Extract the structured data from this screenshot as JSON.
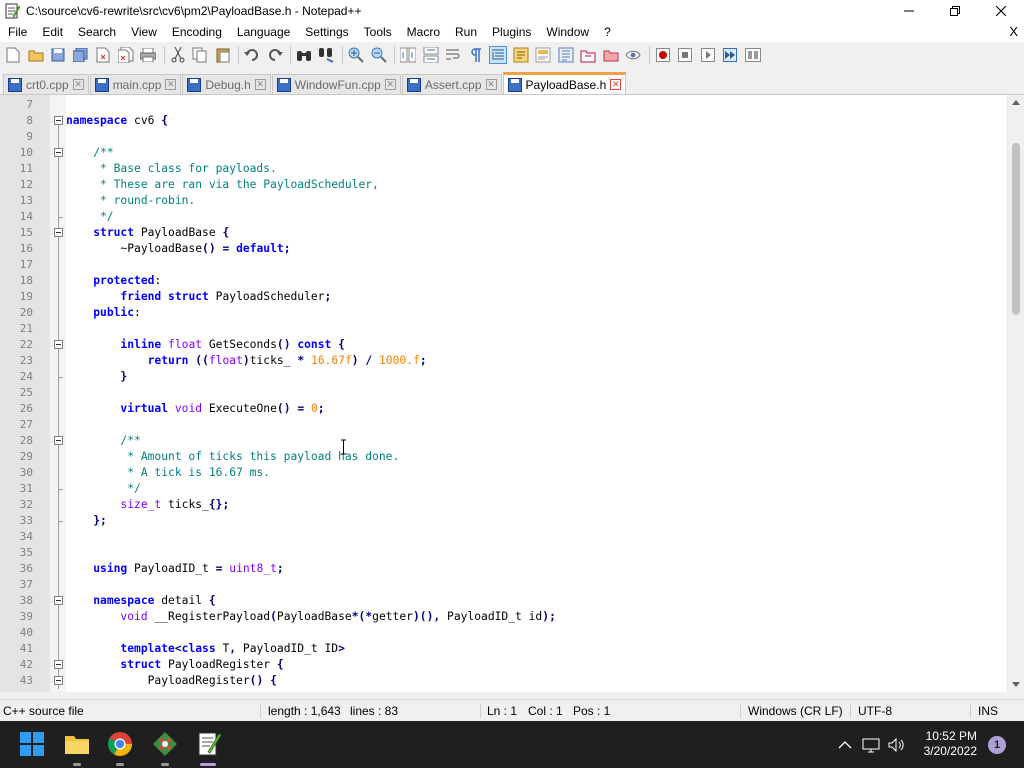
{
  "window": {
    "title": "C:\\source\\cv6-rewrite\\src\\cv6\\pm2\\PayloadBase.h - Notepad++"
  },
  "menu": {
    "items": [
      "File",
      "Edit",
      "Search",
      "View",
      "Encoding",
      "Language",
      "Settings",
      "Tools",
      "Macro",
      "Run",
      "Plugins",
      "Window",
      "?"
    ],
    "close_label": "X"
  },
  "tabs": [
    {
      "label": "crt0.cpp",
      "active": false
    },
    {
      "label": "main.cpp",
      "active": false
    },
    {
      "label": "Debug.h",
      "active": false
    },
    {
      "label": "WindowFun.cpp",
      "active": false
    },
    {
      "label": "Assert.cpp",
      "active": false
    },
    {
      "label": "PayloadBase.h",
      "active": true
    }
  ],
  "editor": {
    "lines": [
      {
        "n": "7",
        "text": ""
      },
      {
        "n": "8",
        "text": "namespace cv6 {"
      },
      {
        "n": "9",
        "text": ""
      },
      {
        "n": "10",
        "text": "    /**"
      },
      {
        "n": "11",
        "text": "     * Base class for payloads."
      },
      {
        "n": "12",
        "text": "     * These are ran via the PayloadScheduler,"
      },
      {
        "n": "13",
        "text": "     * round-robin."
      },
      {
        "n": "14",
        "text": "     */"
      },
      {
        "n": "15",
        "text": "    struct PayloadBase {"
      },
      {
        "n": "16",
        "text": "        ~PayloadBase() = default;"
      },
      {
        "n": "17",
        "text": ""
      },
      {
        "n": "18",
        "text": "    protected:"
      },
      {
        "n": "19",
        "text": "        friend struct PayloadScheduler;"
      },
      {
        "n": "20",
        "text": "    public:"
      },
      {
        "n": "21",
        "text": ""
      },
      {
        "n": "22",
        "text": "        inline float GetSeconds() const {"
      },
      {
        "n": "23",
        "text": "            return ((float)ticks_ * 16.67f) / 1000.f;"
      },
      {
        "n": "24",
        "text": "        }"
      },
      {
        "n": "25",
        "text": ""
      },
      {
        "n": "26",
        "text": "        virtual void ExecuteOne() = 0;"
      },
      {
        "n": "27",
        "text": ""
      },
      {
        "n": "28",
        "text": "        /**"
      },
      {
        "n": "29",
        "text": "         * Amount of ticks this payload has done."
      },
      {
        "n": "30",
        "text": "         * A tick is 16.67 ms."
      },
      {
        "n": "31",
        "text": "         */"
      },
      {
        "n": "32",
        "text": "        size_t ticks_{};"
      },
      {
        "n": "33",
        "text": "    };"
      },
      {
        "n": "34",
        "text": ""
      },
      {
        "n": "35",
        "text": ""
      },
      {
        "n": "36",
        "text": "    using PayloadID_t = uint8_t;"
      },
      {
        "n": "37",
        "text": ""
      },
      {
        "n": "38",
        "text": "    namespace detail {"
      },
      {
        "n": "39",
        "text": "        void __RegisterPayload(PayloadBase*(*getter)(), PayloadID_t id);"
      },
      {
        "n": "40",
        "text": ""
      },
      {
        "n": "41",
        "text": "        template<class T, PayloadID_t ID>"
      },
      {
        "n": "42",
        "text": "        struct PayloadRegister {"
      },
      {
        "n": "43",
        "text": "            PayloadRegister() {"
      }
    ]
  },
  "status": {
    "file_type": "C++ source file",
    "length": "length : 1,643",
    "lines": "lines : 83",
    "ln": "Ln : 1",
    "col": "Col : 1",
    "pos": "Pos : 1",
    "eol": "Windows (CR LF)",
    "encoding": "UTF-8",
    "mode": "INS"
  },
  "taskbar": {
    "time": "10:52 PM",
    "date": "3/20/2022",
    "notification_count": "1"
  },
  "colors": {
    "keyword": "#0000ff",
    "type": "#8000ff",
    "comment": "#008080",
    "number": "#ff8000",
    "active_tab_accent": "#f0a14a"
  }
}
